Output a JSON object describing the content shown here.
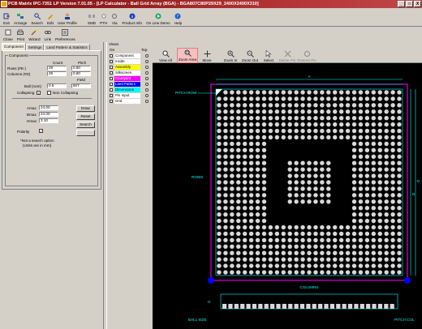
{
  "window": {
    "title": "PCB Matrix IPC-7351 LP Version  7.01.05 - [LP Calculator - Ball Grid Array (BGA) - BGA807C80P29X29_2400X2400X310]",
    "controls": [
      "_",
      "□",
      "X"
    ]
  },
  "toolbar_main": [
    {
      "label": "Exit",
      "icon": "exit-icon"
    },
    {
      "label": "Arrange",
      "icon": "arrange-icon"
    },
    {
      "label": "Search",
      "icon": "search-icon"
    },
    {
      "label": "Edit",
      "icon": "edit-icon"
    },
    {
      "label": "User Profile",
      "icon": "user-profile-icon"
    },
    {
      "label": "SMD",
      "icon": "smd-icon"
    },
    {
      "label": "PTH",
      "icon": "pth-icon"
    },
    {
      "label": "Via",
      "icon": "via-icon"
    },
    {
      "label": "Product Info",
      "icon": "info-icon"
    },
    {
      "label": "On Line Demo",
      "icon": "demo-icon"
    },
    {
      "label": "Help",
      "icon": "help-icon"
    }
  ],
  "toolbar_secondary": [
    {
      "label": "Close",
      "icon": "close-icon"
    },
    {
      "label": "Print",
      "icon": "print-icon"
    },
    {
      "label": "Wizard",
      "icon": "wizard-icon"
    },
    {
      "label": "Link",
      "icon": "link-icon"
    },
    {
      "label": "Preferences",
      "icon": "preferences-icon"
    }
  ],
  "tabs": [
    "Component",
    "Settings",
    "Land Pattern & Statistics"
  ],
  "component": {
    "group_title": "Component",
    "col_count": "Count",
    "col_pitch": "Pitch",
    "rows_label": "Rows (#E-)",
    "rows_count": "29",
    "rows_pitch": "0.80",
    "cols_label": "Columns (#D)",
    "cols_count": "29",
    "cols_pitch": "0.80",
    "field_label": "Field",
    "ball_label": "Ball (nom)",
    "ball_value": "0.5",
    "field_value": "807",
    "collapsing_label": "Collapsing",
    "noncollapsing_label": "Non Collapsing",
    "amax_label": "Amax",
    "amax_value": "24.00",
    "bmax_label": "Bmax",
    "bmax_value": "24.00",
    "hmax_label": "Hmax",
    "hmax_value": "3.10",
    "draw_button": "Draw",
    "reset_button": "Reset",
    "search_button": "Search",
    "polarity_label": "Polarity",
    "note_line1": "*Not a search option",
    "note_line2": "(Units are in mm)"
  },
  "layers": {
    "header": "Views",
    "col_on": "On",
    "col_top": "Top",
    "items": [
      {
        "name": "Component",
        "color": "#ffffff"
      },
      {
        "name": "Inside",
        "color": "#ffffff"
      },
      {
        "name": "Assembly",
        "color": "#ffff00"
      },
      {
        "name": "Silkscreen",
        "color": "#ffffff"
      },
      {
        "name": "Courtyard",
        "color": "#ff00ff"
      },
      {
        "name": "Land Pattern",
        "color": "#0000ff"
      },
      {
        "name": "Dimensions",
        "color": "#00ffff"
      },
      {
        "name": "Pin Input",
        "color": "#ffffff"
      },
      {
        "name": "Grid",
        "color": "#ffffff"
      }
    ]
  },
  "view_toolbar": [
    {
      "label": "View All",
      "icon": "zoom-all-icon"
    },
    {
      "label": "Zoom Area",
      "icon": "zoom-area-icon"
    },
    {
      "label": "Move",
      "icon": "move-icon"
    },
    {
      "label": "Zoom In",
      "icon": "zoom-in-icon"
    },
    {
      "label": "Zoom Out",
      "icon": "zoom-out-icon"
    },
    {
      "label": "Select",
      "icon": "select-icon"
    },
    {
      "label": "Delete Pin",
      "icon": "delete-pin-icon"
    },
    {
      "label": "Restore Pin",
      "icon": "restore-pin-icon"
    }
  ],
  "drawing": {
    "label_a": "A",
    "label_b": "B",
    "label_d": "D",
    "label_e": "E",
    "label_pitch_row": "PITCH ROW",
    "label_rows": "ROWS",
    "label_columns": "COLUMNS",
    "label_h": "H",
    "label_ball_size": "BALL SIZE",
    "label_pitch_col": "PITCH COL",
    "colors": {
      "dimension": "#00ffff",
      "courtyard": "#ff00ff",
      "pad": "#d8d8d8",
      "marker": "#0000ff"
    }
  }
}
